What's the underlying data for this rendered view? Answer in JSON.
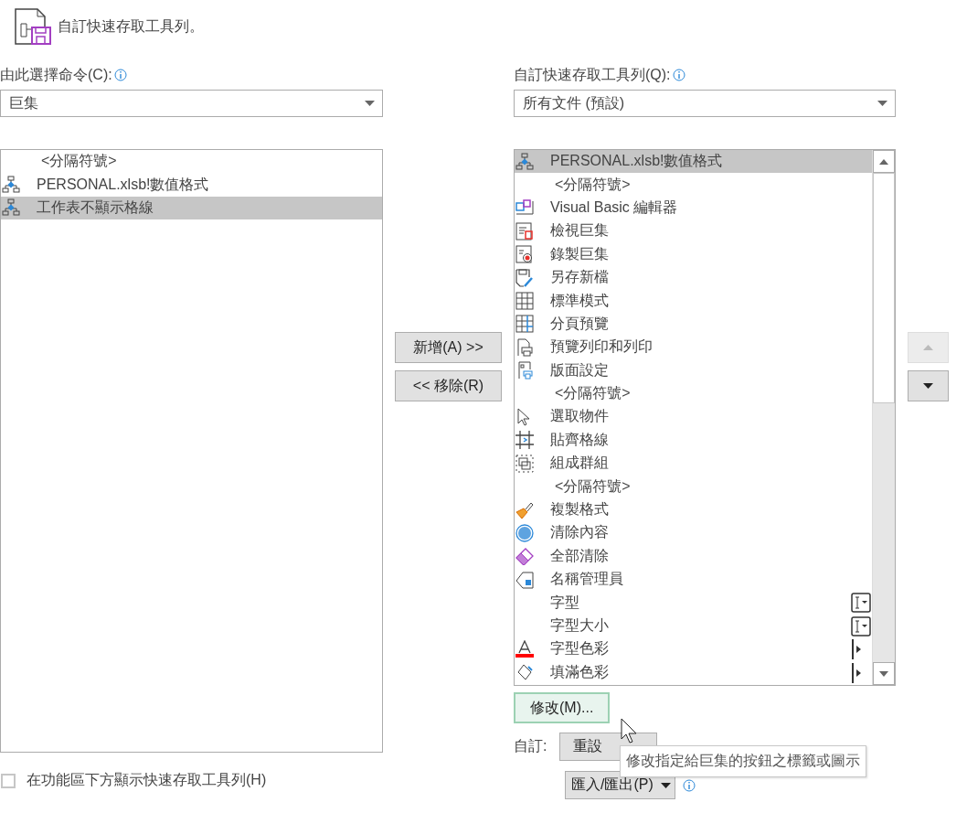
{
  "header": {
    "title": "自訂快速存取工具列。"
  },
  "left": {
    "label": "由此選擇命令(C):",
    "dropdown": {
      "value": "巨集"
    },
    "items": [
      {
        "label": "<分隔符號>",
        "kind": "separator",
        "selected": false
      },
      {
        "label": "PERSONAL.xlsb!數值格式",
        "kind": "macro",
        "selected": false
      },
      {
        "label": "工作表不顯示格線",
        "kind": "macro",
        "selected": true
      }
    ],
    "checkbox": {
      "label": "在功能區下方顯示快速存取工具列(H)",
      "checked": false
    }
  },
  "middle": {
    "add_button": "新增(A) >>",
    "remove_button": "<< 移除(R)"
  },
  "right": {
    "label": "自訂快速存取工具列(Q):",
    "dropdown": {
      "value": "所有文件 (預設)"
    },
    "items": [
      {
        "label": "PERSONAL.xlsb!數值格式",
        "kind": "macro",
        "selected": true
      },
      {
        "label": "<分隔符號>",
        "kind": "separator",
        "selected": false
      },
      {
        "label": "Visual Basic 編輯器",
        "kind": "vba",
        "selected": false
      },
      {
        "label": "檢視巨集",
        "kind": "view-macros",
        "selected": false
      },
      {
        "label": "錄製巨集",
        "kind": "record-macro",
        "selected": false
      },
      {
        "label": "另存新檔",
        "kind": "save-as",
        "selected": false
      },
      {
        "label": "標準模式",
        "kind": "grid",
        "selected": false
      },
      {
        "label": "分頁預覽",
        "kind": "page-break",
        "selected": false
      },
      {
        "label": "預覽列印和列印",
        "kind": "print",
        "selected": false
      },
      {
        "label": "版面設定",
        "kind": "page-setup",
        "selected": false
      },
      {
        "label": "<分隔符號>",
        "kind": "separator",
        "selected": false
      },
      {
        "label": "選取物件",
        "kind": "select",
        "selected": false
      },
      {
        "label": "貼齊格線",
        "kind": "snap",
        "selected": false
      },
      {
        "label": "組成群組",
        "kind": "group",
        "selected": false
      },
      {
        "label": "<分隔符號>",
        "kind": "separator",
        "selected": false
      },
      {
        "label": "複製格式",
        "kind": "format-painter",
        "selected": false
      },
      {
        "label": "清除內容",
        "kind": "clear-contents",
        "selected": false
      },
      {
        "label": "全部清除",
        "kind": "clear-all",
        "selected": false
      },
      {
        "label": "名稱管理員",
        "kind": "name-manager",
        "selected": false
      },
      {
        "label": "字型",
        "kind": "font",
        "selected": false
      },
      {
        "label": "字型大小",
        "kind": "font-size",
        "selected": false
      },
      {
        "label": "字型色彩",
        "kind": "font-color",
        "selected": false
      },
      {
        "label": "填滿色彩",
        "kind": "fill-color",
        "selected": false
      }
    ],
    "modify_button": "修改(M)...",
    "customize_label": "自訂:",
    "reset_button": "重設",
    "import_export_button": "匯入/匯出(P)",
    "move_up": {
      "disabled": true
    },
    "move_down": {
      "disabled": false
    },
    "tooltip": "修改指定給巨集的按鈕之標籤或圖示"
  }
}
